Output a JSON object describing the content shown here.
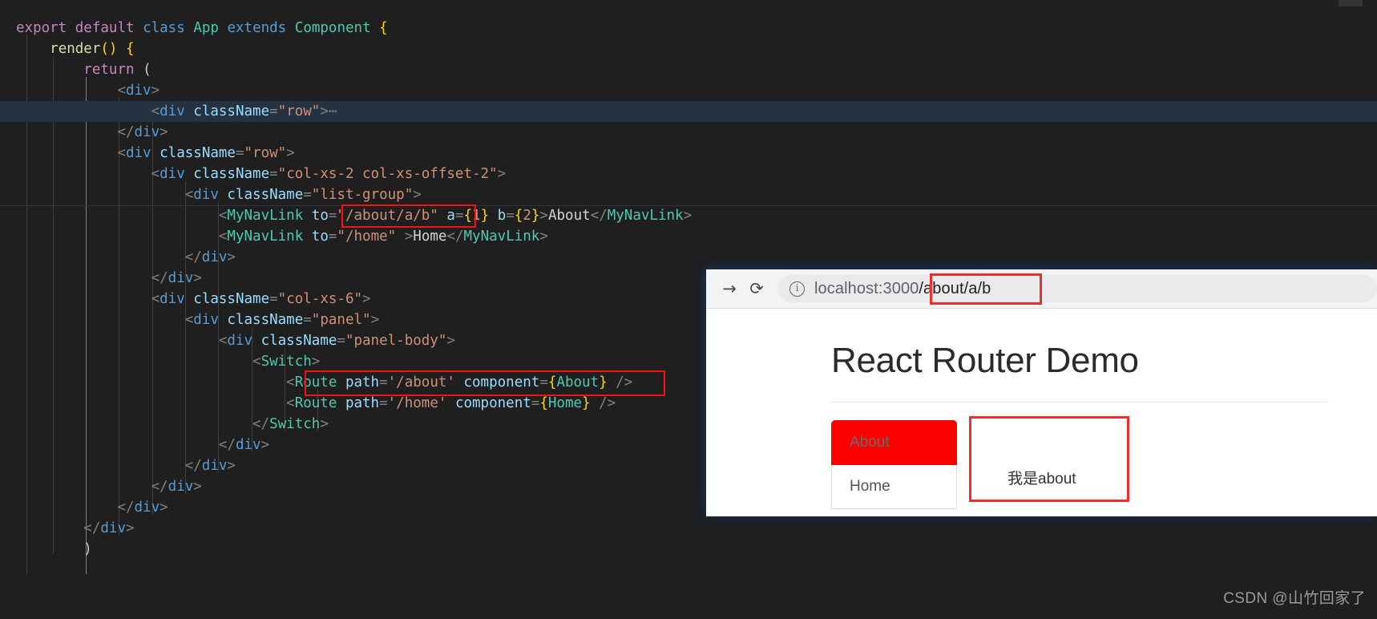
{
  "editor": {
    "theme_background": "#1f1f1f",
    "active_line_background": "#243242",
    "fold_arrow": "❯",
    "lines": [
      {
        "id": 1,
        "indent": 0,
        "text": "export default class App extends Component {"
      },
      {
        "id": 2,
        "indent": 1,
        "text": "render() {"
      },
      {
        "id": 3,
        "indent": 2,
        "text": "return ("
      },
      {
        "id": 4,
        "indent": 3,
        "text": "<div>"
      },
      {
        "id": 5,
        "indent": 4,
        "text": "<div className=\"row\">⋯",
        "active": true
      },
      {
        "id": 6,
        "indent": 4,
        "text": "</div>"
      },
      {
        "id": 7,
        "indent": 4,
        "text": "<div className=\"row\">"
      },
      {
        "id": 8,
        "indent": 5,
        "text": "<div className=\"col-xs-2 col-xs-offset-2\">"
      },
      {
        "id": 9,
        "indent": 6,
        "text": "<div className=\"list-group\">"
      },
      {
        "id": 10,
        "indent": 7,
        "text": "<MyNavLink to=\"/about/a/b\" a={1} b={2}>About</MyNavLink>"
      },
      {
        "id": 11,
        "indent": 7,
        "text": "<MyNavLink to=\"/home\" >Home</MyNavLink>"
      },
      {
        "id": 12,
        "indent": 6,
        "text": "</div>"
      },
      {
        "id": 13,
        "indent": 5,
        "text": "</div>"
      },
      {
        "id": 14,
        "indent": 5,
        "text": "<div className=\"col-xs-6\">"
      },
      {
        "id": 15,
        "indent": 6,
        "text": "<div className=\"panel\">"
      },
      {
        "id": 16,
        "indent": 7,
        "text": "<div className=\"panel-body\">"
      },
      {
        "id": 17,
        "indent": 8,
        "text": "<Switch>"
      },
      {
        "id": 18,
        "indent": 9,
        "text": "<Route path='/about' component={About} />"
      },
      {
        "id": 19,
        "indent": 9,
        "text": "<Route path='/home' component={Home} />"
      },
      {
        "id": 20,
        "indent": 8,
        "text": "</Switch>"
      },
      {
        "id": 21,
        "indent": 7,
        "text": "</div>"
      },
      {
        "id": 22,
        "indent": 6,
        "text": "</div>"
      },
      {
        "id": 23,
        "indent": 5,
        "text": "</div>"
      },
      {
        "id": 24,
        "indent": 4,
        "text": "</div>"
      },
      {
        "id": 25,
        "indent": 3,
        "text": "</div>"
      },
      {
        "id": 26,
        "indent": 2,
        "text": ")"
      }
    ]
  },
  "annotations": {
    "color": "#f01414",
    "boxes": [
      {
        "name": "nav-to-prop-highlight",
        "label": "to=\"/about/a/b\""
      },
      {
        "name": "route-about-highlight",
        "label": "<Route path='/about' component={About} />"
      },
      {
        "name": "url-path-highlight",
        "label": "/about/a/b"
      },
      {
        "name": "about-content-highlight",
        "label": "我是about"
      }
    ]
  },
  "browser": {
    "toolbar": {
      "forward_icon": "→",
      "reload_icon": "⟳",
      "site_info_icon": "ⓘ",
      "url_host": "localhost:3000",
      "url_path": "/about/a/b"
    },
    "page": {
      "title": "React Router Demo",
      "nav": {
        "items": [
          {
            "label": "About",
            "active": true,
            "background": "#fd0000"
          },
          {
            "label": "Home",
            "active": false,
            "background": "#ffffff"
          }
        ]
      },
      "panel_content": "我是about"
    }
  },
  "watermark": {
    "text": "CSDN @山竹回家了"
  }
}
